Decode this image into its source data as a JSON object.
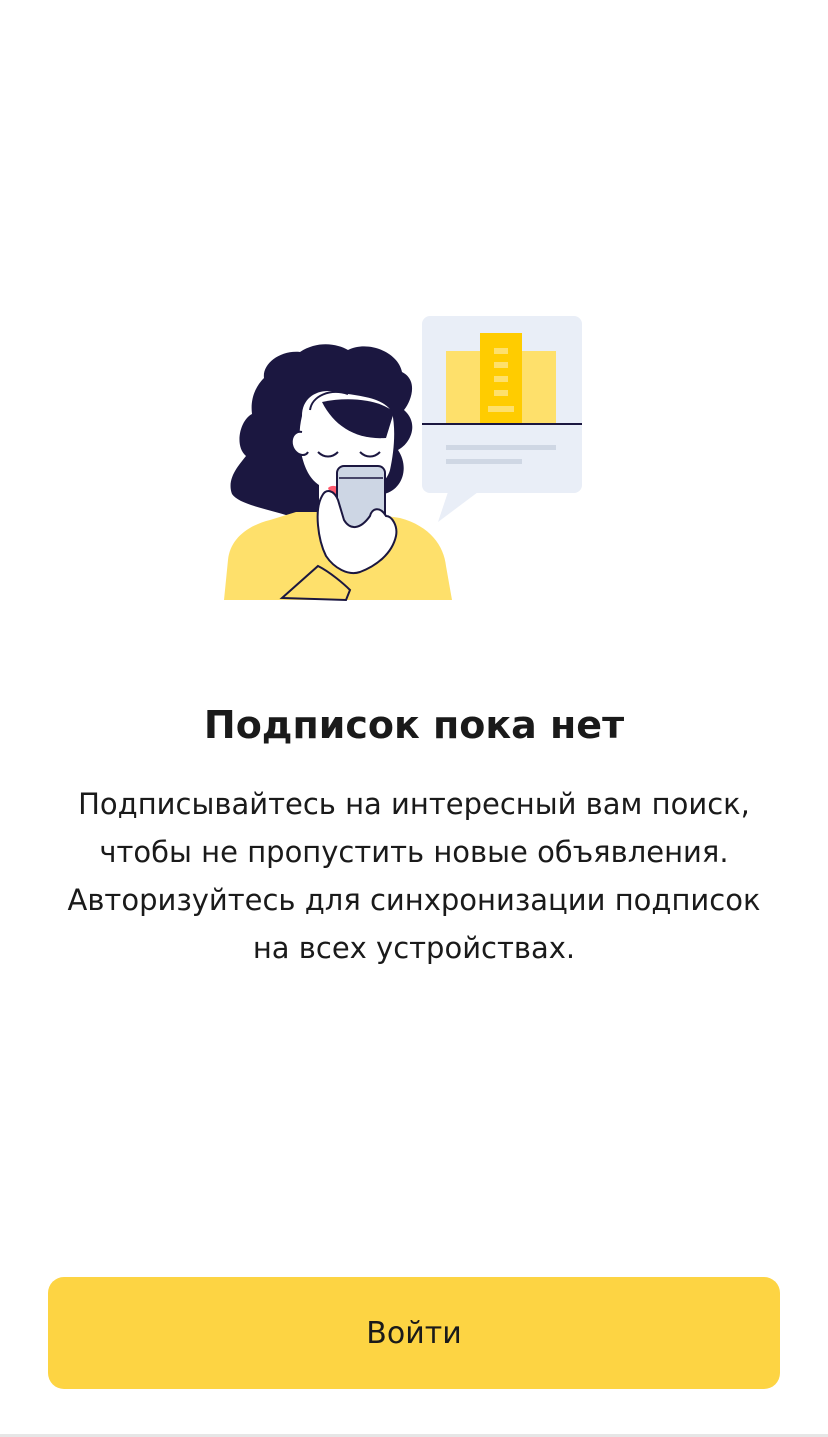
{
  "empty_state": {
    "illustration_icon": "woman-with-phone-illustration",
    "title": "Подписок пока нет",
    "description_lines": [
      "Подписывайтесь на интересный вам поиск,",
      "чтобы не пропустить новые объявления.",
      "Авторизуйтесь для синхронизации подписок",
      "на всех устройствах."
    ]
  },
  "login_button": {
    "label": "Войти"
  },
  "colors": {
    "accent": "#fdd443",
    "hair": "#1b1740",
    "sweater": "#fee06b",
    "card": "#e9eef7"
  }
}
